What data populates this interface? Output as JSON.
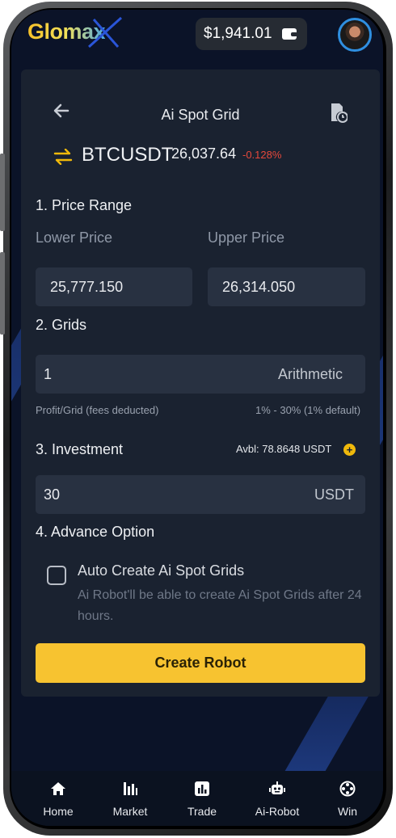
{
  "header": {
    "brand": "Glomax",
    "balance": "$1,941.01",
    "wallet_icon": "wallet-icon",
    "avatar_icon": "user-avatar"
  },
  "page": {
    "title": "Ai Spot Grid",
    "back_icon": "arrow-left-icon",
    "history_icon": "document-clock-icon"
  },
  "ticker": {
    "swap_icon": "swap-arrows-icon",
    "pair": "BTCUSDT",
    "price": "26,037.64",
    "change": "-0.128%"
  },
  "price_range": {
    "section": "1. Price Range",
    "lower_label": "Lower Price",
    "upper_label": "Upper Price",
    "lower_value": "25,777.150",
    "upper_value": "26,314.050"
  },
  "grids": {
    "section": "2. Grids",
    "value": "1",
    "mode": "Arithmetic",
    "profit_label": "Profit/Grid (fees deducted)",
    "profit_range": "1% - 30% (1% default)"
  },
  "investment": {
    "section": "3. Investment",
    "available": "Avbl: 78.8648 USDT",
    "value": "30",
    "unit": "USDT"
  },
  "advance": {
    "section": "4. Advance Option",
    "option_title": "Auto Create Ai Spot Grids",
    "option_desc": "Ai Robot'll be able to create Ai Spot Grids after 24 hours.",
    "checked": false
  },
  "actions": {
    "create": "Create Robot"
  },
  "nav": {
    "items": [
      {
        "label": "Home",
        "icon": "home-icon"
      },
      {
        "label": "Market",
        "icon": "market-bars-icon"
      },
      {
        "label": "Trade",
        "icon": "trade-chart-icon"
      },
      {
        "label": "Ai-Robot",
        "icon": "robot-icon"
      },
      {
        "label": "Win",
        "icon": "gamepad-icon"
      }
    ]
  },
  "colors": {
    "accent": "#f7c330",
    "negative": "#e5483b",
    "card": "#1a2230",
    "screen": "#0b1328"
  }
}
